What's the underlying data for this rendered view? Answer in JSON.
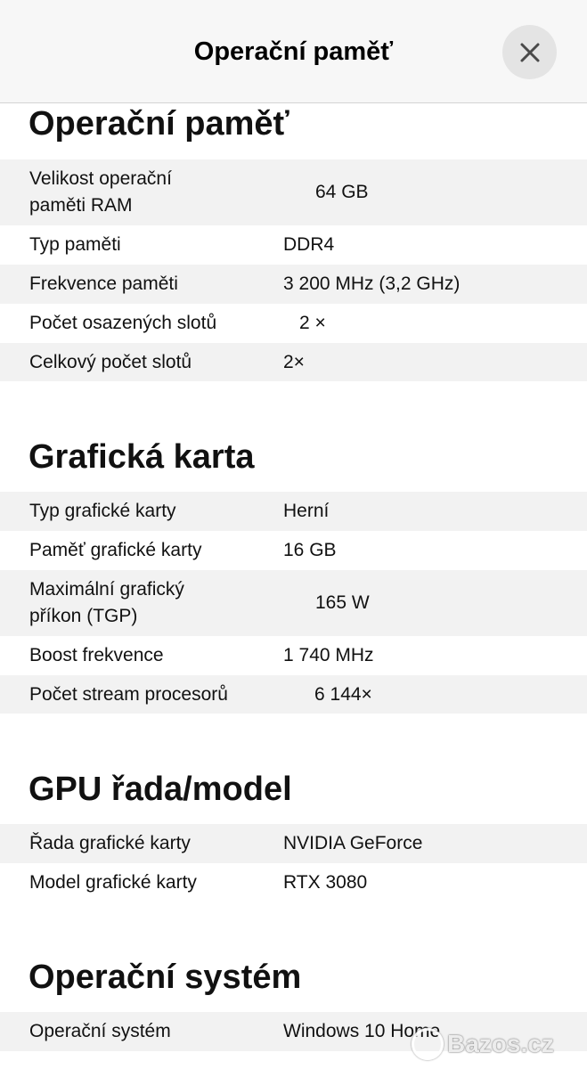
{
  "header": {
    "title": "Operační paměť",
    "close_icon": "close-icon"
  },
  "sections": [
    {
      "title": "Operační paměť",
      "rows": [
        {
          "label": "Velikost operační\npaměti RAM",
          "value": "64 GB"
        },
        {
          "label": "Typ paměti",
          "value": "DDR4"
        },
        {
          "label": "Frekvence paměti",
          "value": "3 200 MHz (3,2 GHz)"
        },
        {
          "label": "Počet osazených slotů",
          "value": "2 ×"
        },
        {
          "label": "Celkový počet slotů",
          "value": "2×"
        }
      ]
    },
    {
      "title": "Grafická karta",
      "rows": [
        {
          "label": "Typ grafické karty",
          "value": "Herní"
        },
        {
          "label": "Paměť grafické karty",
          "value": "16 GB"
        },
        {
          "label": "Maximální grafický\npříkon (TGP)",
          "value": "165 W"
        },
        {
          "label": "Boost frekvence",
          "value": "1 740 MHz"
        },
        {
          "label": "Počet stream procesorů",
          "value": "6 144×"
        }
      ]
    },
    {
      "title": "GPU řada/model",
      "rows": [
        {
          "label": "Řada grafické karty",
          "value": "NVIDIA GeForce"
        },
        {
          "label": "Model grafické karty",
          "value": "RTX 3080"
        }
      ]
    },
    {
      "title": "Operační systém",
      "rows": [
        {
          "label": "Operační systém",
          "value": "Windows 10 Home"
        }
      ]
    }
  ],
  "watermark": {
    "text": "Bazos.cz"
  },
  "colors": {
    "header_bg": "#f7f7f7",
    "row_shaded": "#f2f2f2",
    "close_btn_bg": "#e4e4e4"
  }
}
